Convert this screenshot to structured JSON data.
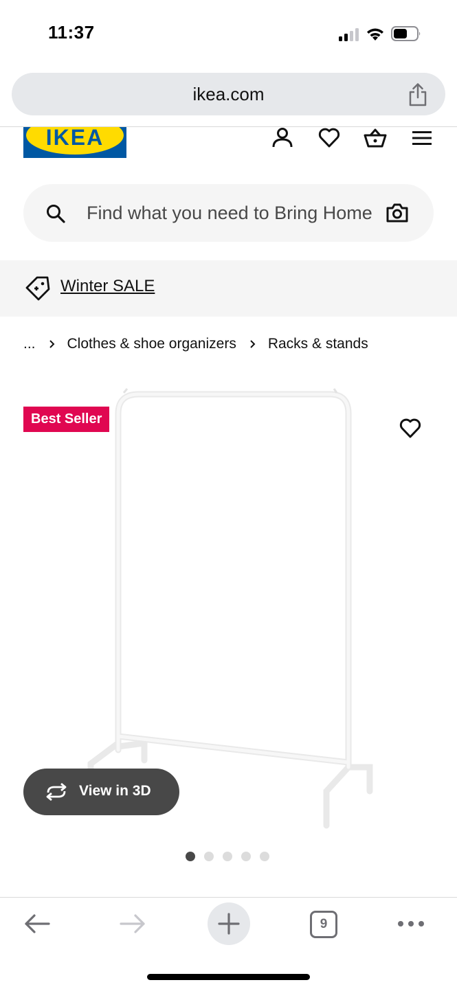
{
  "status_bar": {
    "time": "11:37"
  },
  "browser": {
    "url": "ikea.com",
    "tabs_count": "9"
  },
  "header": {
    "logo_text": "IKEA",
    "icons": [
      "account-icon",
      "favorites-heart-icon",
      "shopping-basket-icon",
      "menu-icon"
    ]
  },
  "search": {
    "placeholder": "Find what you need to Bring Home"
  },
  "promo": {
    "label": "Winter SALE"
  },
  "breadcrumb": {
    "ellipsis": "...",
    "items": [
      "Clothes & shoe organizers",
      "Racks & stands"
    ]
  },
  "product": {
    "badge": "Best Seller",
    "view_3d_label": "View in 3D",
    "image_count": 5,
    "active_image": 1
  },
  "colors": {
    "ikea_blue": "#0058a3",
    "ikea_yellow": "#ffdb00",
    "badge_red": "#e00751",
    "button_dark": "#484848"
  }
}
